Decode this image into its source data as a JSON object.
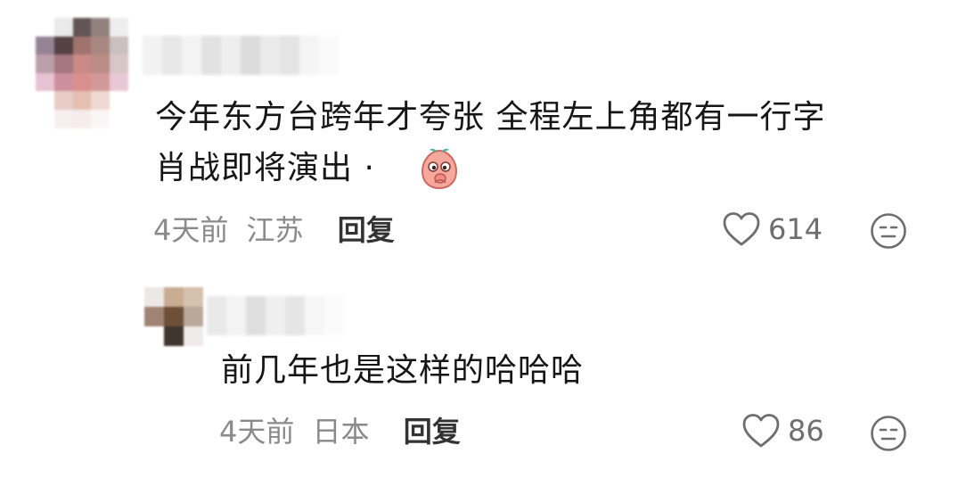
{
  "comment": {
    "text_line1": "今年东方台跨年才夸张 全程左上角都有一行字",
    "text_line2": "肖战即将演出 ·",
    "emoji": "peach-sticker",
    "time": "4天前",
    "location": "江苏",
    "reply_label": "回复",
    "like_count": "614"
  },
  "reply": {
    "text": "前几年也是这样的哈哈哈",
    "time": "4天前",
    "location": "日本",
    "reply_label": "回复",
    "like_count": "86"
  },
  "icons": {
    "like": "heart-outline-icon",
    "dislike": "meh-face-icon"
  },
  "colors": {
    "text_primary": "#161616",
    "text_secondary": "#8a8a8a",
    "reply_action": "#333333"
  }
}
